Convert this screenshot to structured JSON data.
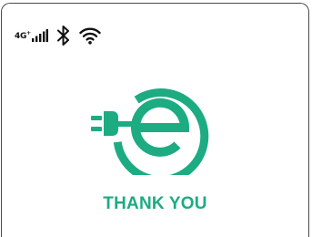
{
  "status_bar": {
    "network_label": "4G",
    "network_suffix": "+",
    "icons": [
      "signal-bars-icon",
      "bluetooth-icon",
      "wifi-icon"
    ]
  },
  "main": {
    "logo": "ev-charging-plug-e-logo",
    "message": "THANK YOU"
  },
  "colors": {
    "brand_green": "#1dab82",
    "frame": "#4a4a4a",
    "status_icons": "#111111"
  }
}
